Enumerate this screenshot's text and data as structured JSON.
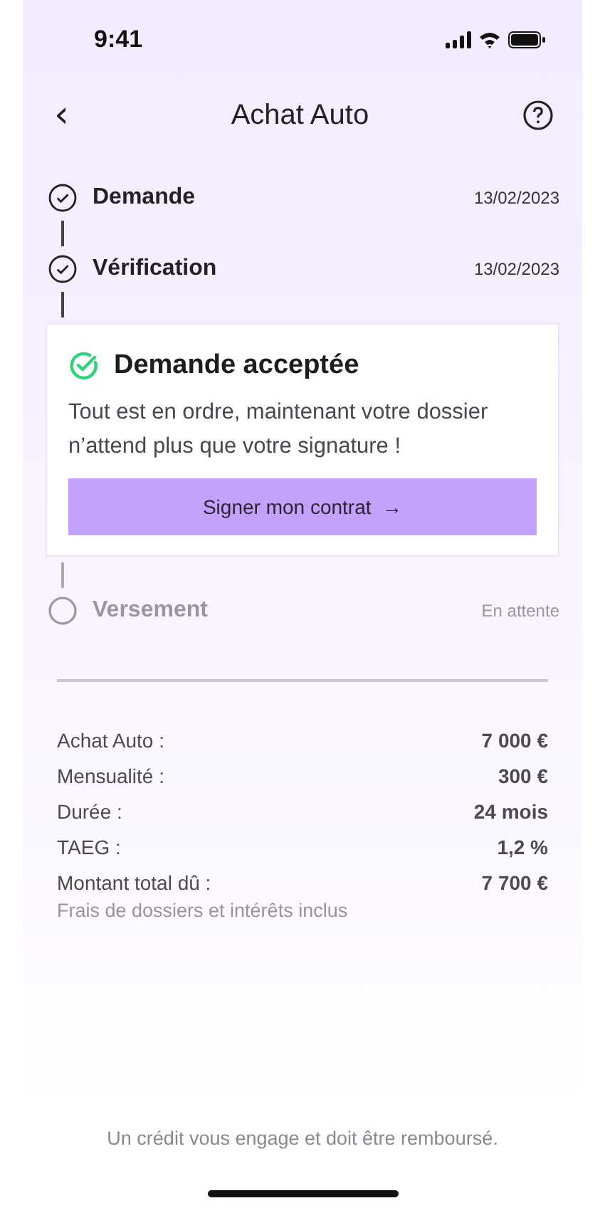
{
  "status_bar": {
    "time": "9:41"
  },
  "header": {
    "back": "‹",
    "title": "Achat Auto"
  },
  "steps": [
    {
      "kind": "done",
      "label": "Demande",
      "date": "13/02/2023"
    },
    {
      "kind": "done",
      "label": "Vérification",
      "date": "13/02/2023"
    },
    {
      "kind": "current",
      "title": "Demande acceptée",
      "message": "Tout est en ordre, maintenant votre dossier n’attend plus que votre signature !",
      "button": "Signer mon contrat",
      "button_arrow": "→"
    },
    {
      "kind": "pending",
      "label": "Versement",
      "status": "En attente"
    }
  ],
  "summary": [
    {
      "label": "Achat Auto :",
      "value": "7 000 €"
    },
    {
      "label": "Mensualité :",
      "value": "300 €"
    },
    {
      "label": "Durée :",
      "value": "24 mois"
    },
    {
      "label": "TAEG :",
      "value": "1,2 %"
    },
    {
      "label": "Montant total dû :",
      "value": "7 700 €"
    }
  ],
  "summary_note": "Frais de dossiers et intérêts inclus",
  "footer": "Un crédit vous engage et doit être remboursé."
}
